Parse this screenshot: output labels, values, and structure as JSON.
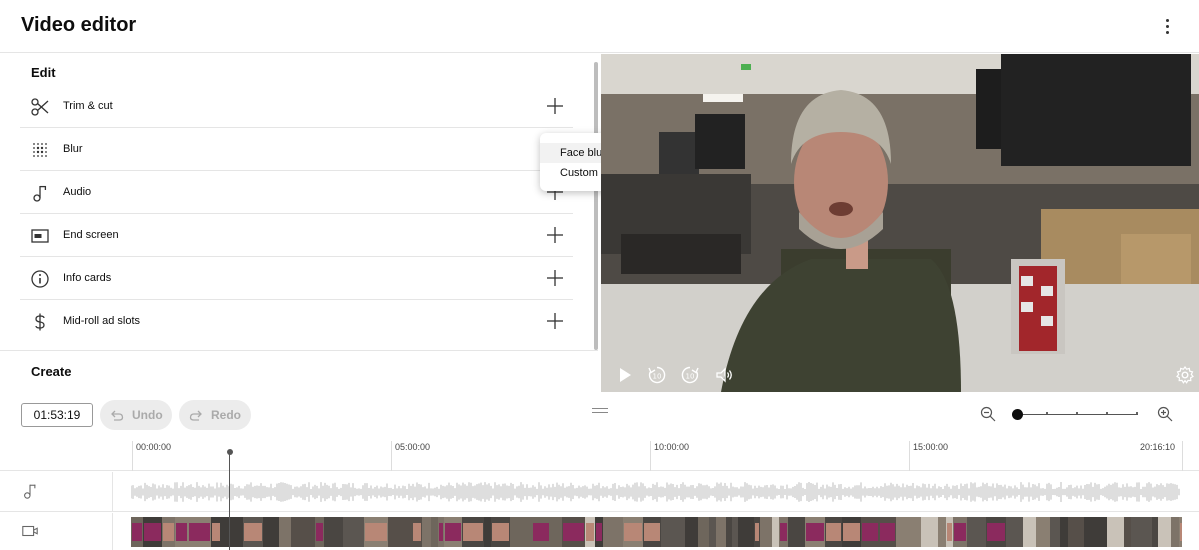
{
  "header": {
    "title": "Video editor",
    "more_icon": "more-vert-icon"
  },
  "left_panel": {
    "edit_title": "Edit",
    "items": [
      {
        "label": "Trim & cut",
        "icon": "scissors-icon",
        "action_icon": "plus-icon"
      },
      {
        "label": "Blur",
        "icon": "blur-icon",
        "action_icon": "plus-icon"
      },
      {
        "label": "Audio",
        "icon": "music-note-icon",
        "action_icon": "plus-icon"
      },
      {
        "label": "End screen",
        "icon": "end-screen-icon",
        "action_icon": "plus-icon"
      },
      {
        "label": "Info cards",
        "icon": "info-icon",
        "action_icon": "plus-icon"
      },
      {
        "label": "Mid-roll ad slots",
        "icon": "dollar-icon",
        "action_icon": "plus-icon"
      }
    ],
    "create_title": "Create"
  },
  "blur_menu": {
    "items": [
      "Face blur",
      "Custom blur"
    ],
    "highlighted_index": 0
  },
  "video_controls": {
    "icons": [
      "play-icon",
      "rewind-10-icon",
      "forward-10-icon",
      "volume-icon",
      "settings-icon"
    ]
  },
  "toolbar": {
    "current_time": "01:53:19",
    "undo_label": "Undo",
    "redo_label": "Redo",
    "undo_enabled": false,
    "redo_enabled": false
  },
  "zoom": {
    "out_icon": "zoom-out-icon",
    "in_icon": "zoom-in-icon",
    "level_fraction": 0
  },
  "timeline": {
    "ruler_labels": [
      "00:00:00",
      "05:00:00",
      "10:00:00",
      "15:00:00",
      "20:16:10"
    ],
    "tracks": [
      {
        "name": "audio",
        "icon": "music-note-icon"
      },
      {
        "name": "video",
        "icon": "video-camera-icon"
      }
    ],
    "playhead_time": "01:53:19"
  },
  "colors": {
    "accent": "#065fd4",
    "divider": "#e5e5e5",
    "disabled_text": "#aaaaaa",
    "button_bg": "#ececec"
  }
}
